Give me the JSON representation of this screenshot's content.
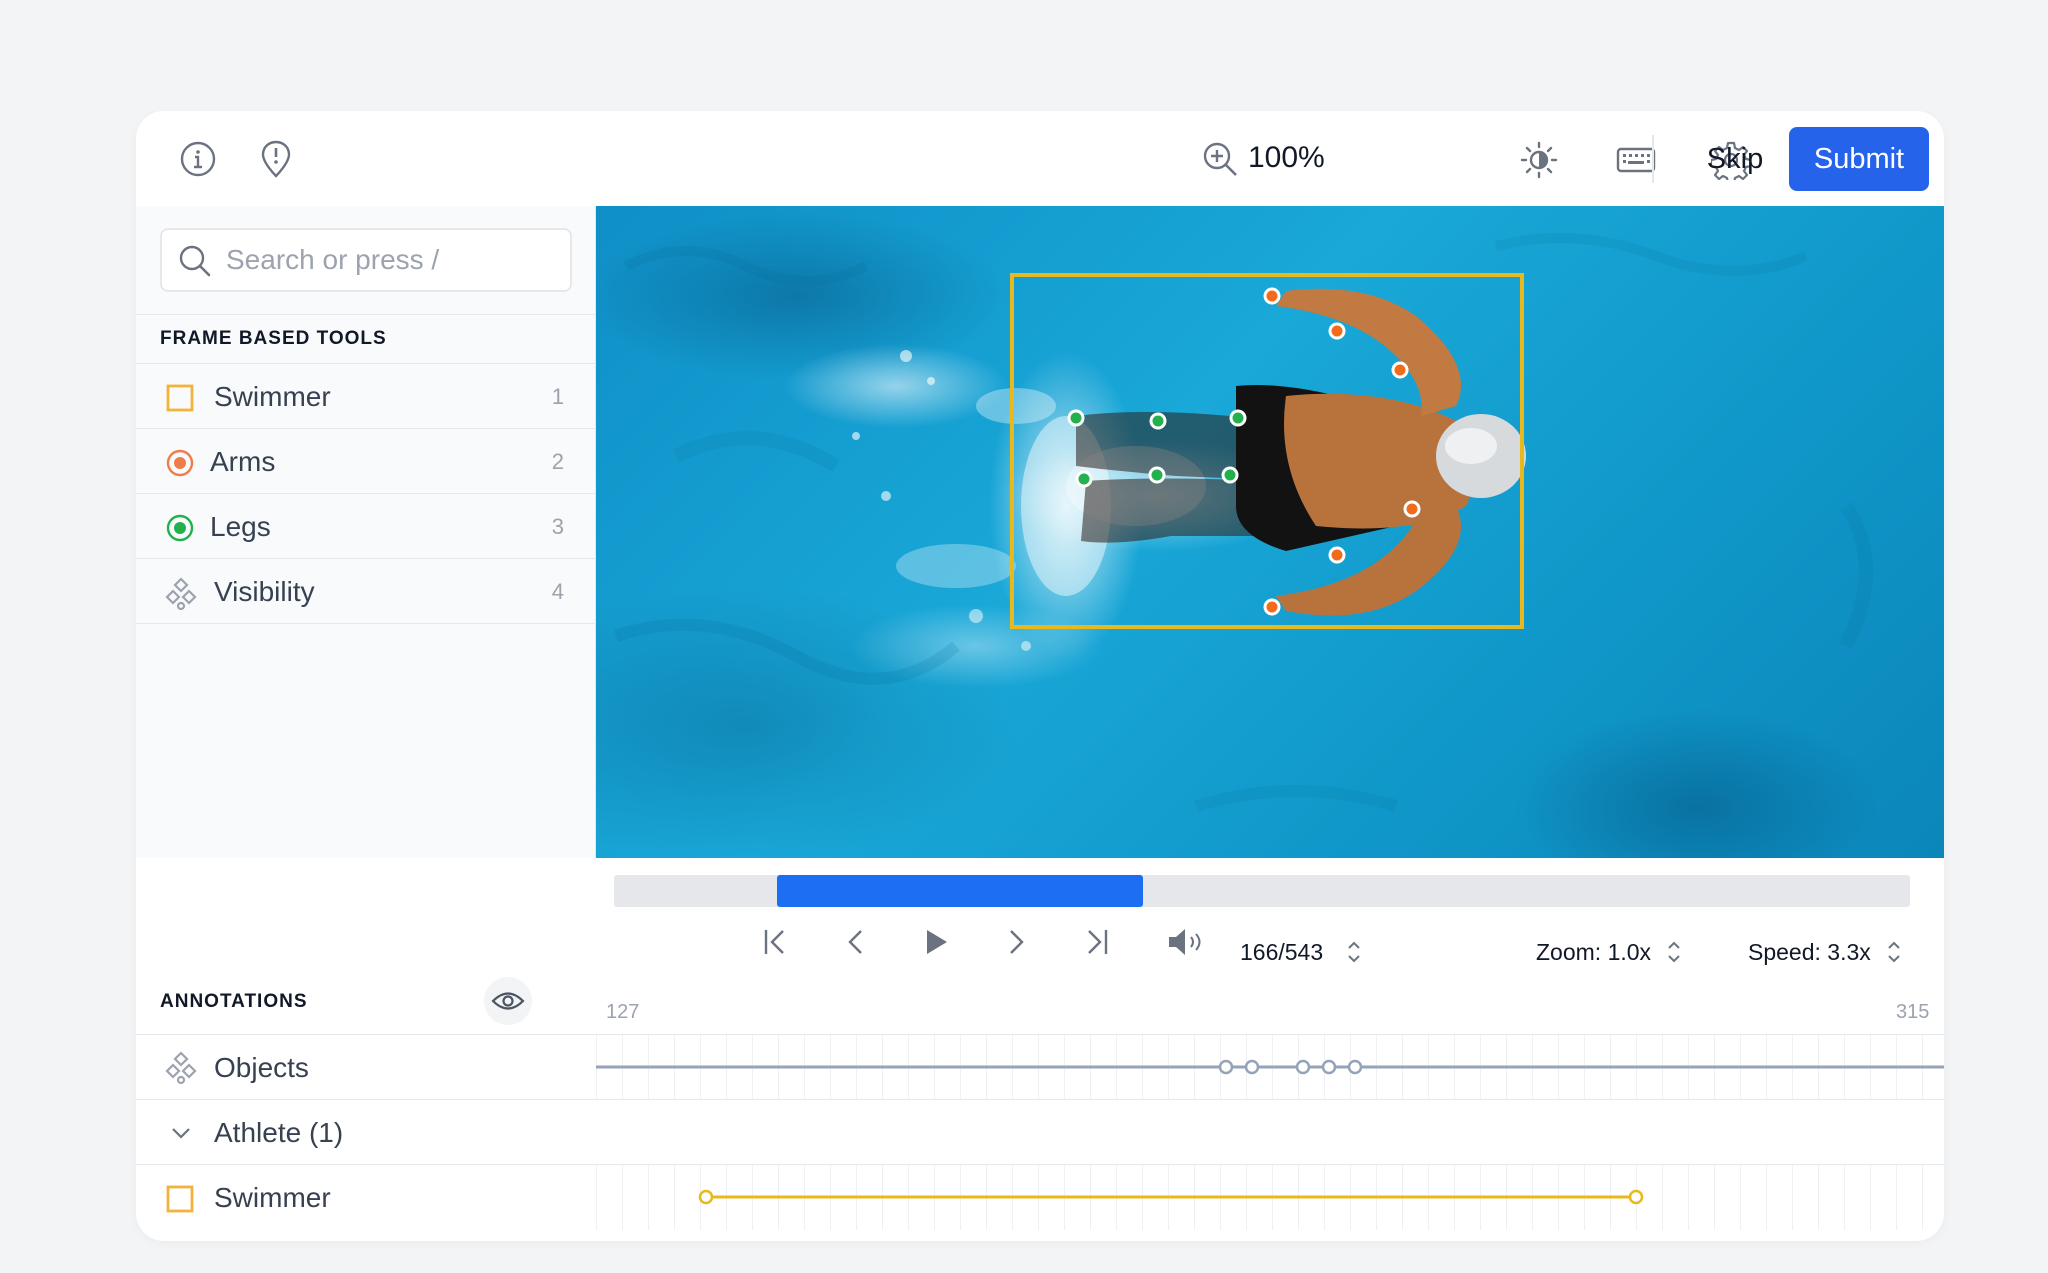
{
  "toolbar": {
    "zoom_label": "100%",
    "skip_label": "Skip",
    "submit_label": "Submit",
    "icons": [
      "info-icon",
      "issue-pin-icon",
      "zoom-in-icon",
      "brightness-icon",
      "keyboard-icon",
      "settings-icon"
    ]
  },
  "search": {
    "placeholder": "Search or press /"
  },
  "tools": {
    "heading": "FRAME BASED TOOLS",
    "items": [
      {
        "label": "Swimmer",
        "shortcut": "1",
        "icon": "bounding-box-icon",
        "color": "#f2b33d"
      },
      {
        "label": "Arms",
        "shortcut": "2",
        "icon": "point-icon",
        "color": "#ef7d4a"
      },
      {
        "label": "Legs",
        "shortcut": "3",
        "icon": "point-icon",
        "color": "#22b14c"
      },
      {
        "label": "Visibility",
        "shortcut": "4",
        "icon": "objects-icon",
        "color": "#9ca3af"
      }
    ]
  },
  "canvas": {
    "box_color": "#e7b91e",
    "arm_point_color": "#f26b1d",
    "leg_point_color": "#22b14c"
  },
  "player": {
    "progress": {
      "start_fraction": 0.126,
      "end_fraction": 0.408
    },
    "frame_counter": "166/543",
    "zoom_label": "Zoom: 1.0x",
    "speed_label": "Speed: 3.3x",
    "range_start": "127",
    "range_end": "315",
    "icons": [
      "skip-to-start-icon",
      "previous-frame-icon",
      "play-icon",
      "next-frame-icon",
      "skip-to-end-icon",
      "volume-icon"
    ]
  },
  "annotations": {
    "heading": "ANNOTATIONS",
    "rows": [
      {
        "label": "Objects",
        "icon": "objects-icon"
      },
      {
        "label": "Athlete (1)",
        "icon": "chevron-down-icon"
      },
      {
        "label": "Swimmer",
        "icon": "bounding-box-icon"
      }
    ],
    "colors": {
      "objects_track": "#94a3b8",
      "swimmer_track": "#e7b91e",
      "accent": "#2563eb"
    }
  }
}
